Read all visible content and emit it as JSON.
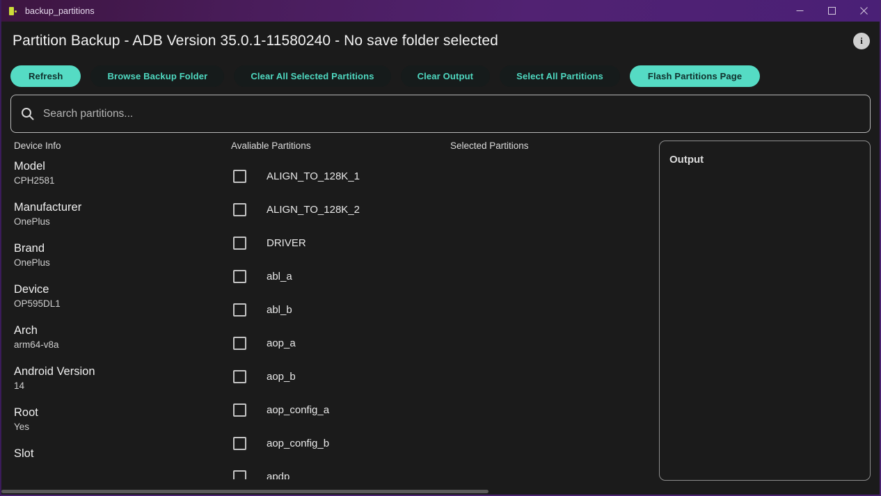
{
  "titlebar": {
    "app_icon": "flutter-app-icon",
    "title": "backup_partitions",
    "minimize_label": "Minimize",
    "maximize_label": "Maximize",
    "close_label": "Close"
  },
  "header": {
    "title": "Partition Backup - ADB Version 35.0.1-11580240 - No save folder selected",
    "info_label": "i"
  },
  "toolbar": {
    "buttons": [
      {
        "label": "Refresh",
        "style": "filled"
      },
      {
        "label": "Browse Backup Folder",
        "style": "outlined"
      },
      {
        "label": "Clear All Selected Partitions",
        "style": "outlined"
      },
      {
        "label": "Clear Output",
        "style": "outlined"
      },
      {
        "label": "Select All Partitions",
        "style": "outlined"
      },
      {
        "label": "Flash Partitions Page",
        "style": "filled"
      }
    ]
  },
  "search": {
    "icon": "search-icon",
    "placeholder": "Search partitions...",
    "value": ""
  },
  "device_info": {
    "header": "Device Info",
    "fields": [
      {
        "label": "Model",
        "value": "CPH2581"
      },
      {
        "label": "Manufacturer",
        "value": "OnePlus"
      },
      {
        "label": "Brand",
        "value": "OnePlus"
      },
      {
        "label": "Device",
        "value": "OP595DL1"
      },
      {
        "label": "Arch",
        "value": "arm64-v8a"
      },
      {
        "label": "Android Version",
        "value": "14"
      },
      {
        "label": "Root",
        "value": "Yes"
      },
      {
        "label": "Slot",
        "value": ""
      }
    ]
  },
  "available_partitions": {
    "header": "Avaliable Partitions",
    "items": [
      {
        "label": "ALIGN_TO_128K_1",
        "checked": false
      },
      {
        "label": "ALIGN_TO_128K_2",
        "checked": false
      },
      {
        "label": "DRIVER",
        "checked": false
      },
      {
        "label": "abl_a",
        "checked": false
      },
      {
        "label": "abl_b",
        "checked": false
      },
      {
        "label": "aop_a",
        "checked": false
      },
      {
        "label": "aop_b",
        "checked": false
      },
      {
        "label": "aop_config_a",
        "checked": false
      },
      {
        "label": "aop_config_b",
        "checked": false
      },
      {
        "label": "apdp",
        "checked": false
      }
    ]
  },
  "selected_partitions": {
    "header": "Selected Partitions",
    "items": []
  },
  "output": {
    "title": "Output",
    "text": ""
  },
  "colors": {
    "accent": "#55dbc4",
    "accent_text": "#4fd9c1",
    "background": "#1b1b1b",
    "titlebar_purple": "#4a1d5c",
    "window_border": "#4a2270"
  }
}
